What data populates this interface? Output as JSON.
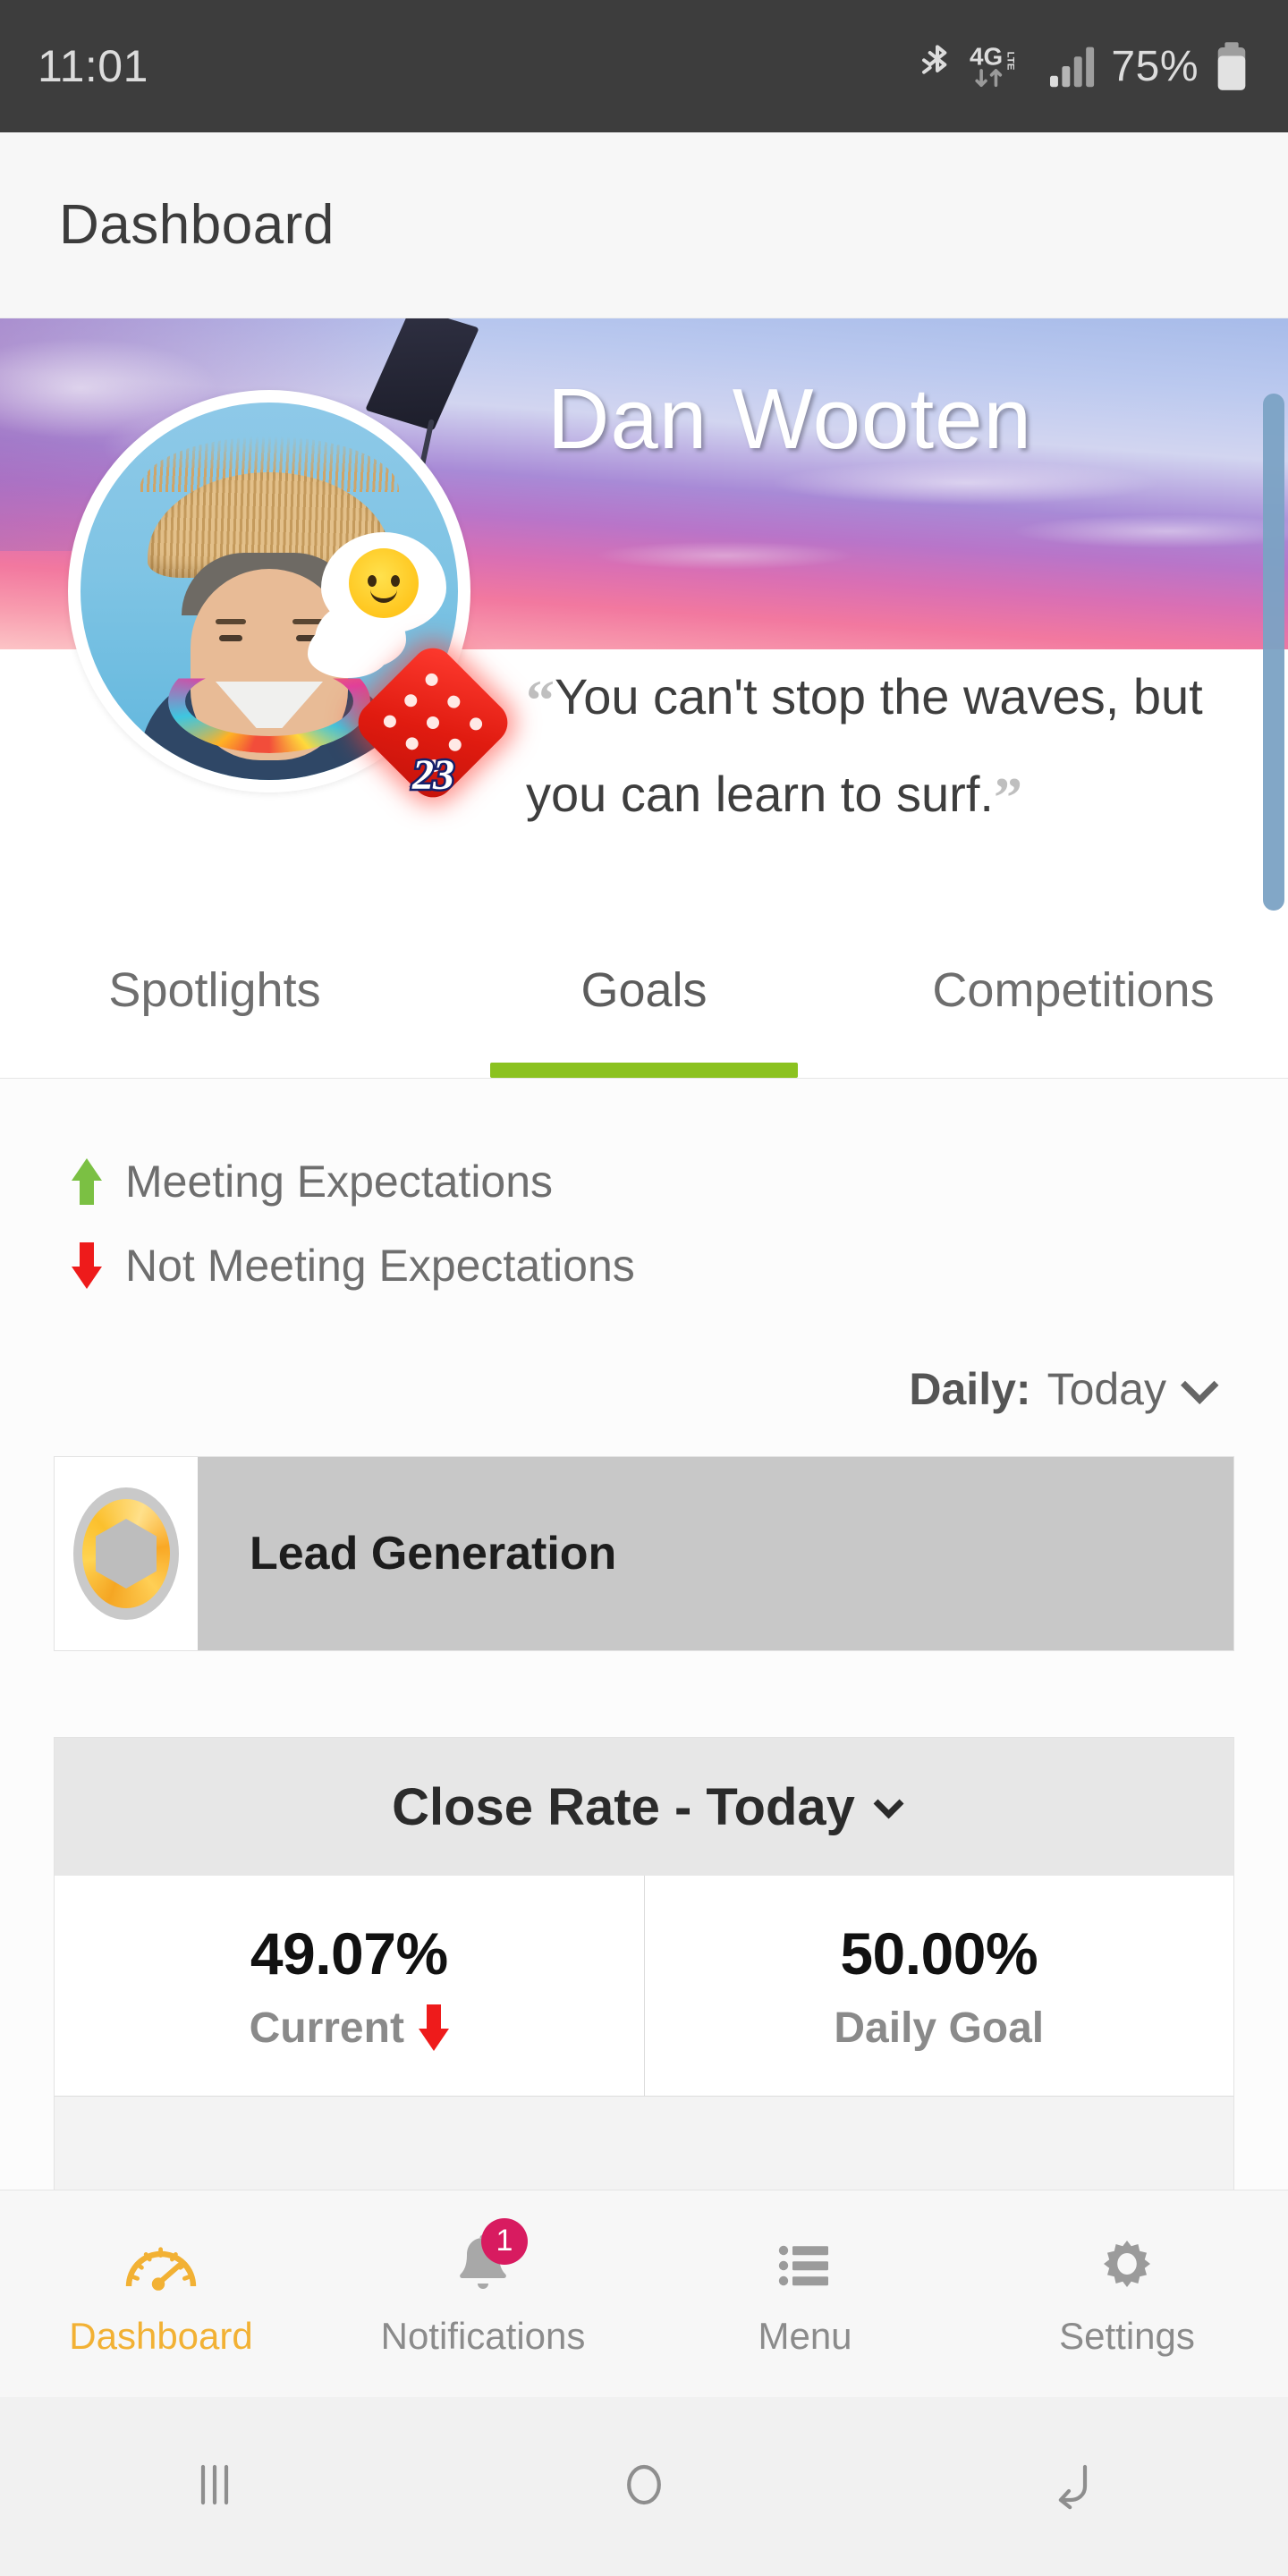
{
  "status_bar": {
    "time": "11:01",
    "battery_percent": "75%",
    "network": "4G LTE",
    "icons": [
      "bluetooth-icon",
      "lte-icon",
      "signal-icon",
      "battery-icon"
    ]
  },
  "app_bar": {
    "title": "Dashboard"
  },
  "profile": {
    "name": "Dan Wooten",
    "quote": "You can't stop the waves, but you can learn to surf.",
    "quote_open": "“",
    "quote_close": "”",
    "dice_badge_number": "23",
    "avatar_alt": "user-avatar"
  },
  "tabs": [
    {
      "label": "Spotlights",
      "active": false
    },
    {
      "label": "Goals",
      "active": true
    },
    {
      "label": "Competitions",
      "active": false
    }
  ],
  "legend": [
    {
      "label": "Meeting Expectations",
      "icon": "arrow-up-icon",
      "color": "#7bc043"
    },
    {
      "label": "Not Meeting Expectations",
      "icon": "arrow-down-icon",
      "color": "#ee1b1b"
    }
  ],
  "period_selector": {
    "key": "Daily:",
    "value": "Today"
  },
  "goal_row": {
    "name": "Lead Generation",
    "badge": "medal-icon"
  },
  "close_rate_card": {
    "title": "Close Rate - Today",
    "stats": [
      {
        "value": "49.07%",
        "label": "Current",
        "trend": "down"
      },
      {
        "value": "50.00%",
        "label": "Daily Goal",
        "trend": "none"
      }
    ]
  },
  "bottom_nav": [
    {
      "label": "Dashboard",
      "icon": "gauge-icon",
      "active": true,
      "badge": ""
    },
    {
      "label": "Notifications",
      "icon": "bell-icon",
      "active": false,
      "badge": "1"
    },
    {
      "label": "Menu",
      "icon": "list-icon",
      "active": false,
      "badge": ""
    },
    {
      "label": "Settings",
      "icon": "gear-icon",
      "active": false,
      "badge": ""
    }
  ],
  "system_nav": [
    {
      "icon": "recents-icon"
    },
    {
      "icon": "home-icon"
    },
    {
      "icon": "back-icon"
    }
  ],
  "colors": {
    "accent_green": "#8bc220",
    "accent_orange": "#f2b134",
    "badge_pink": "#d81b60",
    "negative_red": "#ee1b1b",
    "positive_green": "#7bc043"
  }
}
